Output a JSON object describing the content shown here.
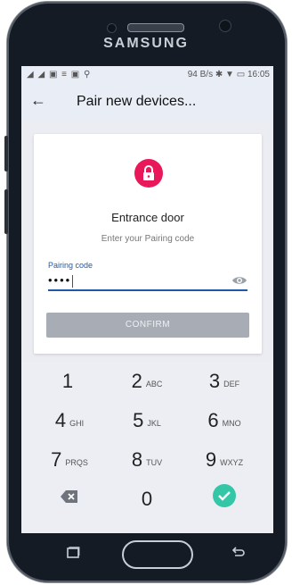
{
  "device": {
    "brand": "SAMSUNG"
  },
  "statusbar": {
    "left_icons": "◢ ◢ ▣ ≡ ▣ ⚲",
    "network_speed": "94 B/s",
    "bluetooth_icon": "bluetooth-icon",
    "signal_icon": "signal-icon",
    "battery_icon": "battery-icon",
    "time": "16:05"
  },
  "appbar": {
    "back_icon": "arrow-back-icon",
    "title": "Pair new devices..."
  },
  "card": {
    "lock_icon": "lock-icon",
    "device_name": "Entrance door",
    "hint": "Enter your Pairing code",
    "field_label": "Pairing code",
    "field_value": "••••",
    "visibility_icon": "eye-icon",
    "confirm_label": "CONFIRM"
  },
  "keypad": {
    "keys": [
      {
        "num": "1",
        "letters": ""
      },
      {
        "num": "2",
        "letters": "ABC"
      },
      {
        "num": "3",
        "letters": "DEF"
      },
      {
        "num": "4",
        "letters": "GHI"
      },
      {
        "num": "5",
        "letters": "JKL"
      },
      {
        "num": "6",
        "letters": "MNO"
      },
      {
        "num": "7",
        "letters": "PRQS"
      },
      {
        "num": "8",
        "letters": "TUV"
      },
      {
        "num": "9",
        "letters": "WXYZ"
      },
      {
        "num": "",
        "letters": ""
      },
      {
        "num": "0",
        "letters": ""
      },
      {
        "num": "",
        "letters": ""
      }
    ],
    "backspace_icon": "backspace-icon",
    "done_icon": "check-icon"
  },
  "colors": {
    "accent": "#1e5aa8",
    "lock": "#e8185a",
    "done": "#33c7a8"
  }
}
